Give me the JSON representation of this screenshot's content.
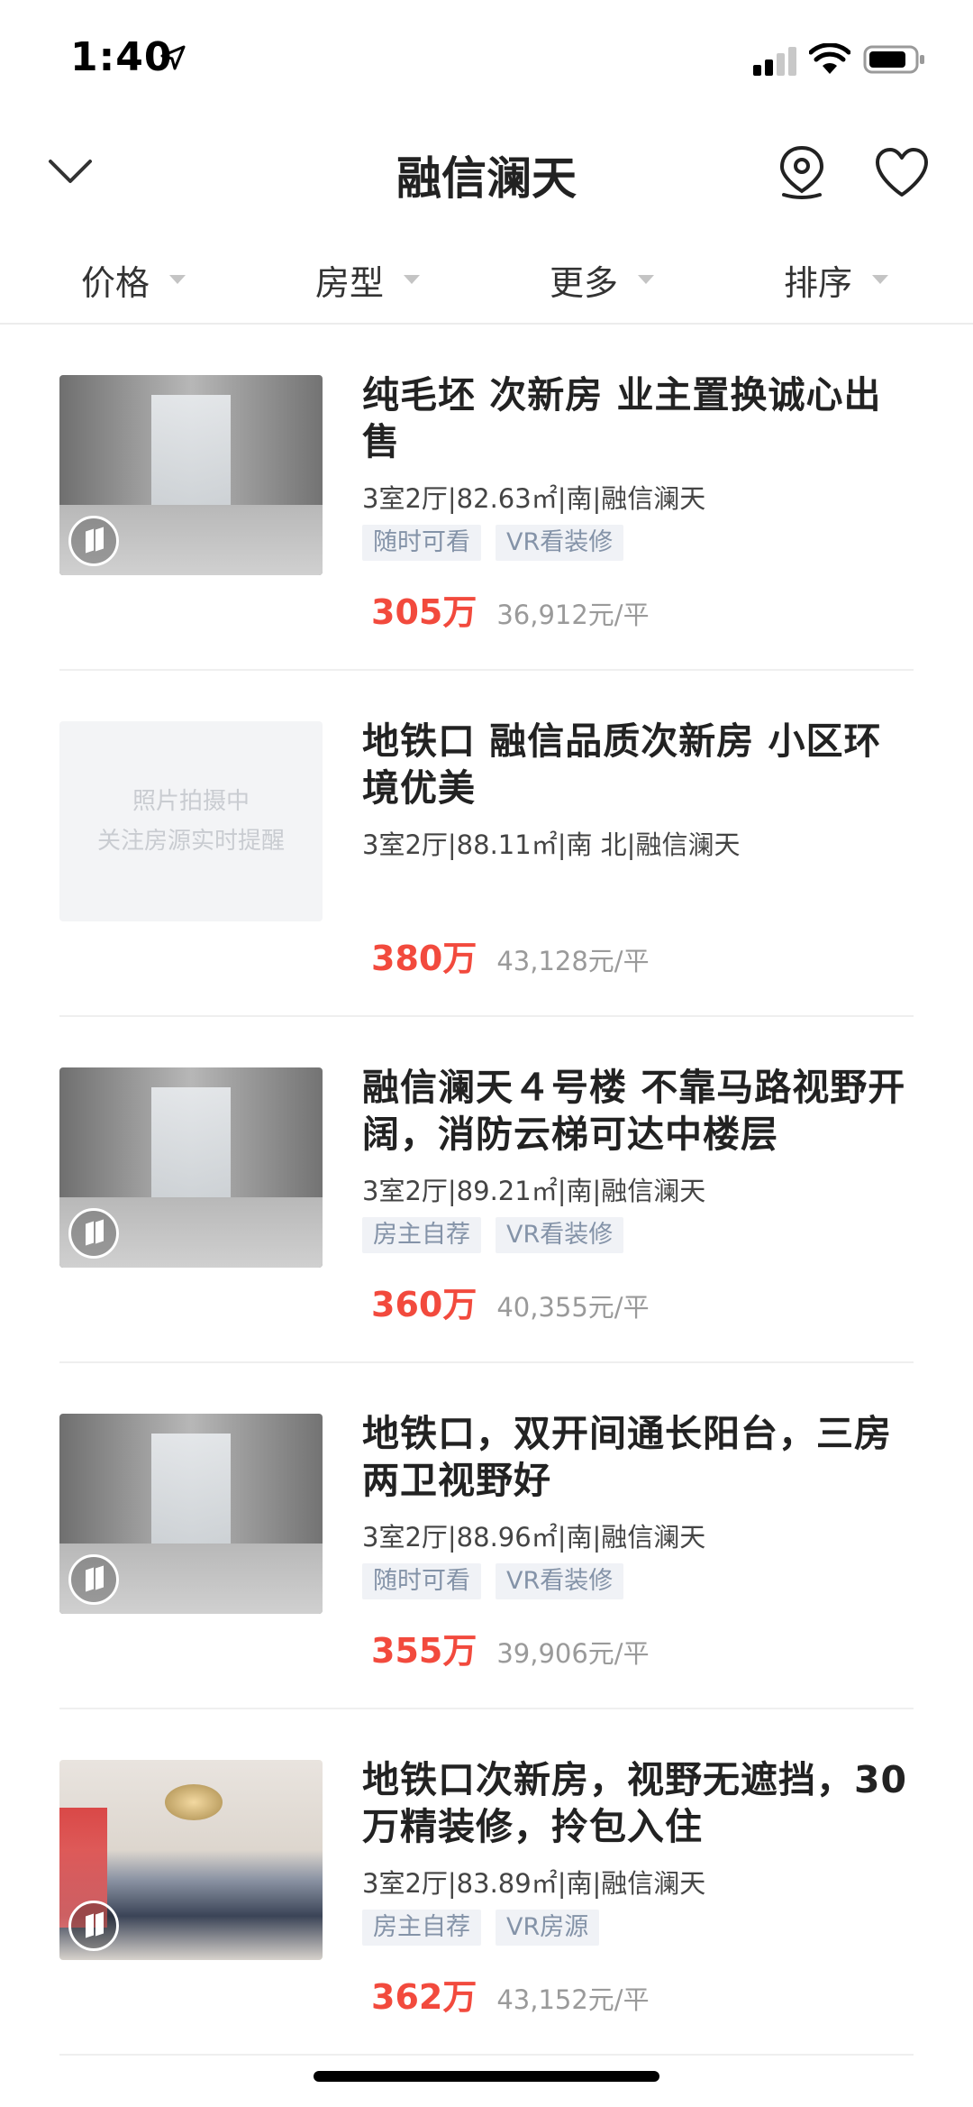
{
  "status_bar": {
    "time": "1:40"
  },
  "nav": {
    "title": "融信澜天",
    "back_icon": "chevron-down-icon",
    "map_icon": "map-pin-icon",
    "fav_icon": "heart-icon"
  },
  "filters": [
    {
      "label": "价格"
    },
    {
      "label": "房型"
    },
    {
      "label": "更多"
    },
    {
      "label": "排序"
    }
  ],
  "listings": [
    {
      "title": "纯毛坯 次新房 业主置换诚心出售",
      "meta": "3室2厅|82.63㎡|南|融信澜天",
      "tags": [
        "随时可看",
        "VR看装修"
      ],
      "price": "305万",
      "unit_price": "36,912元/平",
      "photo": "concrete",
      "vr": true
    },
    {
      "title": "地铁口 融信品质次新房 小区环境优美",
      "meta": "3室2厅|88.11㎡|南 北|融信澜天",
      "tags": [],
      "price": "380万",
      "unit_price": "43,128元/平",
      "photo": "placeholder",
      "placeholder_line1": "照片拍摄中",
      "placeholder_line2": "关注房源实时提醒",
      "vr": false
    },
    {
      "title": "融信澜天４号楼 不靠马路视野开阔，消防云梯可达中楼层",
      "meta": "3室2厅|89.21㎡|南|融信澜天",
      "tags": [
        "房主自荐",
        "VR看装修"
      ],
      "price": "360万",
      "unit_price": "40,355元/平",
      "photo": "concrete",
      "vr": true
    },
    {
      "title": "地铁口，双开间通长阳台，三房两卫视野好",
      "meta": "3室2厅|88.96㎡|南|融信澜天",
      "tags": [
        "随时可看",
        "VR看装修"
      ],
      "price": "355万",
      "unit_price": "39,906元/平",
      "photo": "concrete",
      "vr": true
    },
    {
      "title": "地铁口次新房，视野无遮挡，30万精装修，拎包入住",
      "meta": "3室2厅|83.89㎡|南|融信澜天",
      "tags": [
        "房主自荐",
        "VR房源"
      ],
      "price": "362万",
      "unit_price": "43,152元/平",
      "photo": "decor",
      "vr": true
    }
  ]
}
